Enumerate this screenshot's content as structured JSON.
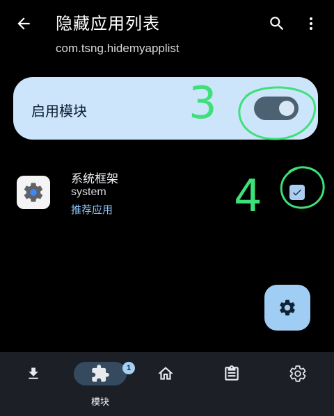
{
  "header": {
    "title": "隐藏应用列表",
    "subtitle": "com.tsng.hidemyapplist",
    "back_icon": "arrow-back-icon",
    "search_icon": "search-icon",
    "more_icon": "more-vert-icon"
  },
  "module_card": {
    "label": "启用模块",
    "switch_on": true
  },
  "annotations": {
    "step_3": "3",
    "step_4": "4",
    "color": "#3ee07a"
  },
  "app_list": [
    {
      "name": "系统框架",
      "package": "system",
      "tag": "推荐应用",
      "checked": true,
      "icon": "gear-icon"
    }
  ],
  "fab": {
    "icon": "gear-icon"
  },
  "bottom_nav": {
    "items": [
      {
        "id": "download",
        "icon": "download-icon",
        "label": ""
      },
      {
        "id": "modules",
        "icon": "extension-icon",
        "label": "模块",
        "badge": "1",
        "active": true
      },
      {
        "id": "home",
        "icon": "home-icon",
        "label": ""
      },
      {
        "id": "logs",
        "icon": "clipboard-icon",
        "label": ""
      },
      {
        "id": "settings",
        "icon": "settings-icon",
        "label": ""
      }
    ]
  },
  "colors": {
    "background": "#000000",
    "card": "#cde5fb",
    "accent": "#9fcdf4",
    "link": "#8fc3f3",
    "nav_bg": "#1c1f25"
  }
}
